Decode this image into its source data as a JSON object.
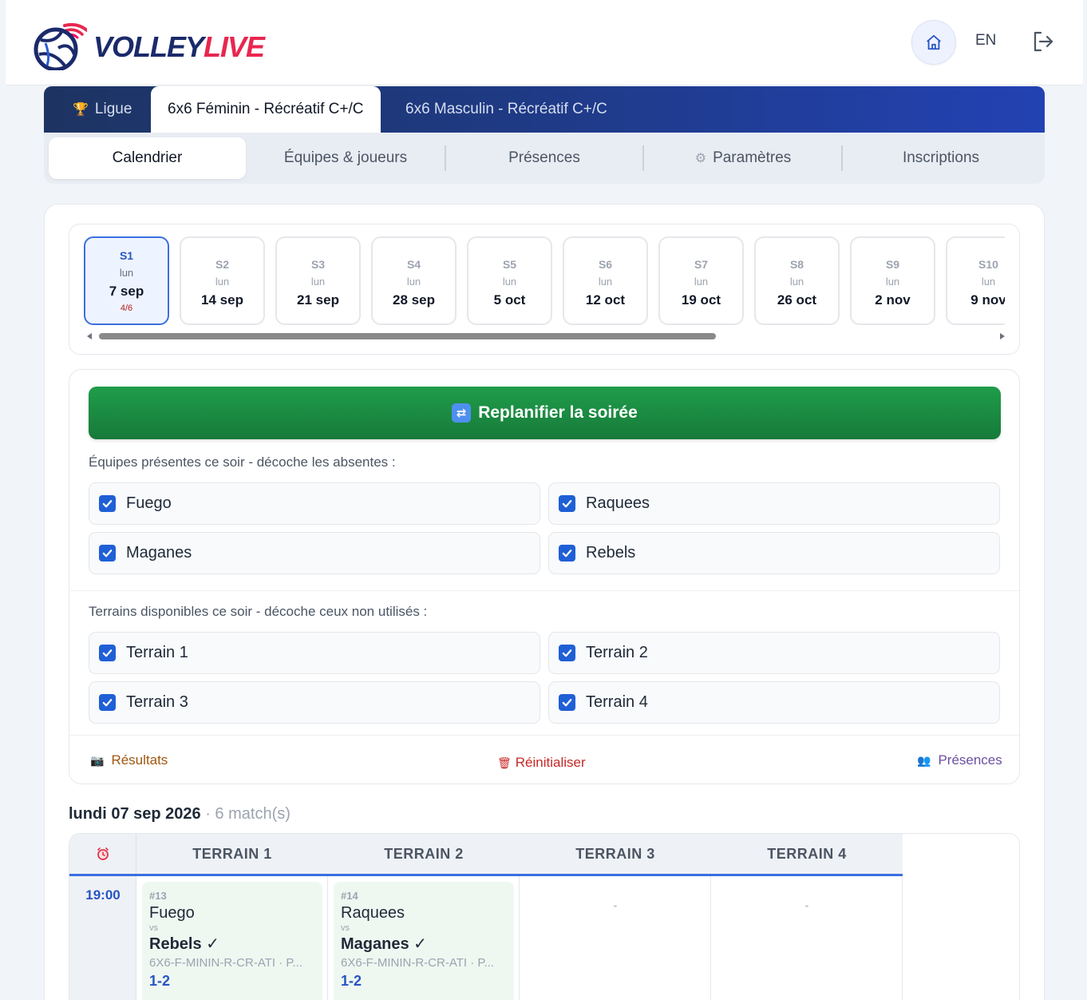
{
  "brand": {
    "volley": "VOLLEY",
    "live": "LIVE"
  },
  "header": {
    "lang": "EN"
  },
  "league_tabs": [
    {
      "label": "Ligue",
      "icon": "trophy-icon"
    },
    {
      "label": "6x6 Féminin - Récréatif C+/C"
    },
    {
      "label": "6x6 Masculin - Récréatif C+/C"
    }
  ],
  "sub_tabs": [
    "Calendrier",
    "Équipes & joueurs",
    "Présences",
    "Paramètres",
    "Inscriptions"
  ],
  "weeks": [
    {
      "code": "S1",
      "day": "lun",
      "date": "7 sep",
      "count": "4/6"
    },
    {
      "code": "S2",
      "day": "lun",
      "date": "14 sep"
    },
    {
      "code": "S3",
      "day": "lun",
      "date": "21 sep"
    },
    {
      "code": "S4",
      "day": "lun",
      "date": "28 sep"
    },
    {
      "code": "S5",
      "day": "lun",
      "date": "5 oct"
    },
    {
      "code": "S6",
      "day": "lun",
      "date": "12 oct"
    },
    {
      "code": "S7",
      "day": "lun",
      "date": "19 oct"
    },
    {
      "code": "S8",
      "day": "lun",
      "date": "26 oct"
    },
    {
      "code": "S9",
      "day": "lun",
      "date": "2 nov"
    },
    {
      "code": "S10",
      "day": "lun",
      "date": "9 nov"
    }
  ],
  "plan": {
    "replan_label": "Replanifier la soirée",
    "teams_label": "Équipes présentes ce soir - décoche les absentes :",
    "teams": [
      "Fuego",
      "Raquees",
      "Maganes",
      "Rebels"
    ],
    "courts_label": "Terrains disponibles ce soir - décoche ceux non utilisés :",
    "courts": [
      "Terrain 1",
      "Terrain 2",
      "Terrain 3",
      "Terrain 4"
    ],
    "results_label": "Résultats",
    "reset_label": "Réinitialiser",
    "presences_label": "Présences"
  },
  "day": {
    "date": "lundi 07 sep 2026",
    "count": "· 6 match(s)"
  },
  "grid": {
    "headers": [
      "TERRAIN 1",
      "TERRAIN 2",
      "TERRAIN 3",
      "TERRAIN 4"
    ],
    "time": "19:00",
    "matches": [
      {
        "num": "#13",
        "team1": "Fuego",
        "vs": "vs",
        "team2": "Rebels ✓",
        "code": "6X6-F-MININ-R-CR-ATI · P...",
        "score": "1-2"
      },
      {
        "num": "#14",
        "team1": "Raquees",
        "vs": "vs",
        "team2": "Maganes ✓",
        "code": "6X6-F-MININ-R-CR-ATI · P...",
        "score": "1-2"
      }
    ],
    "empty": "-"
  }
}
